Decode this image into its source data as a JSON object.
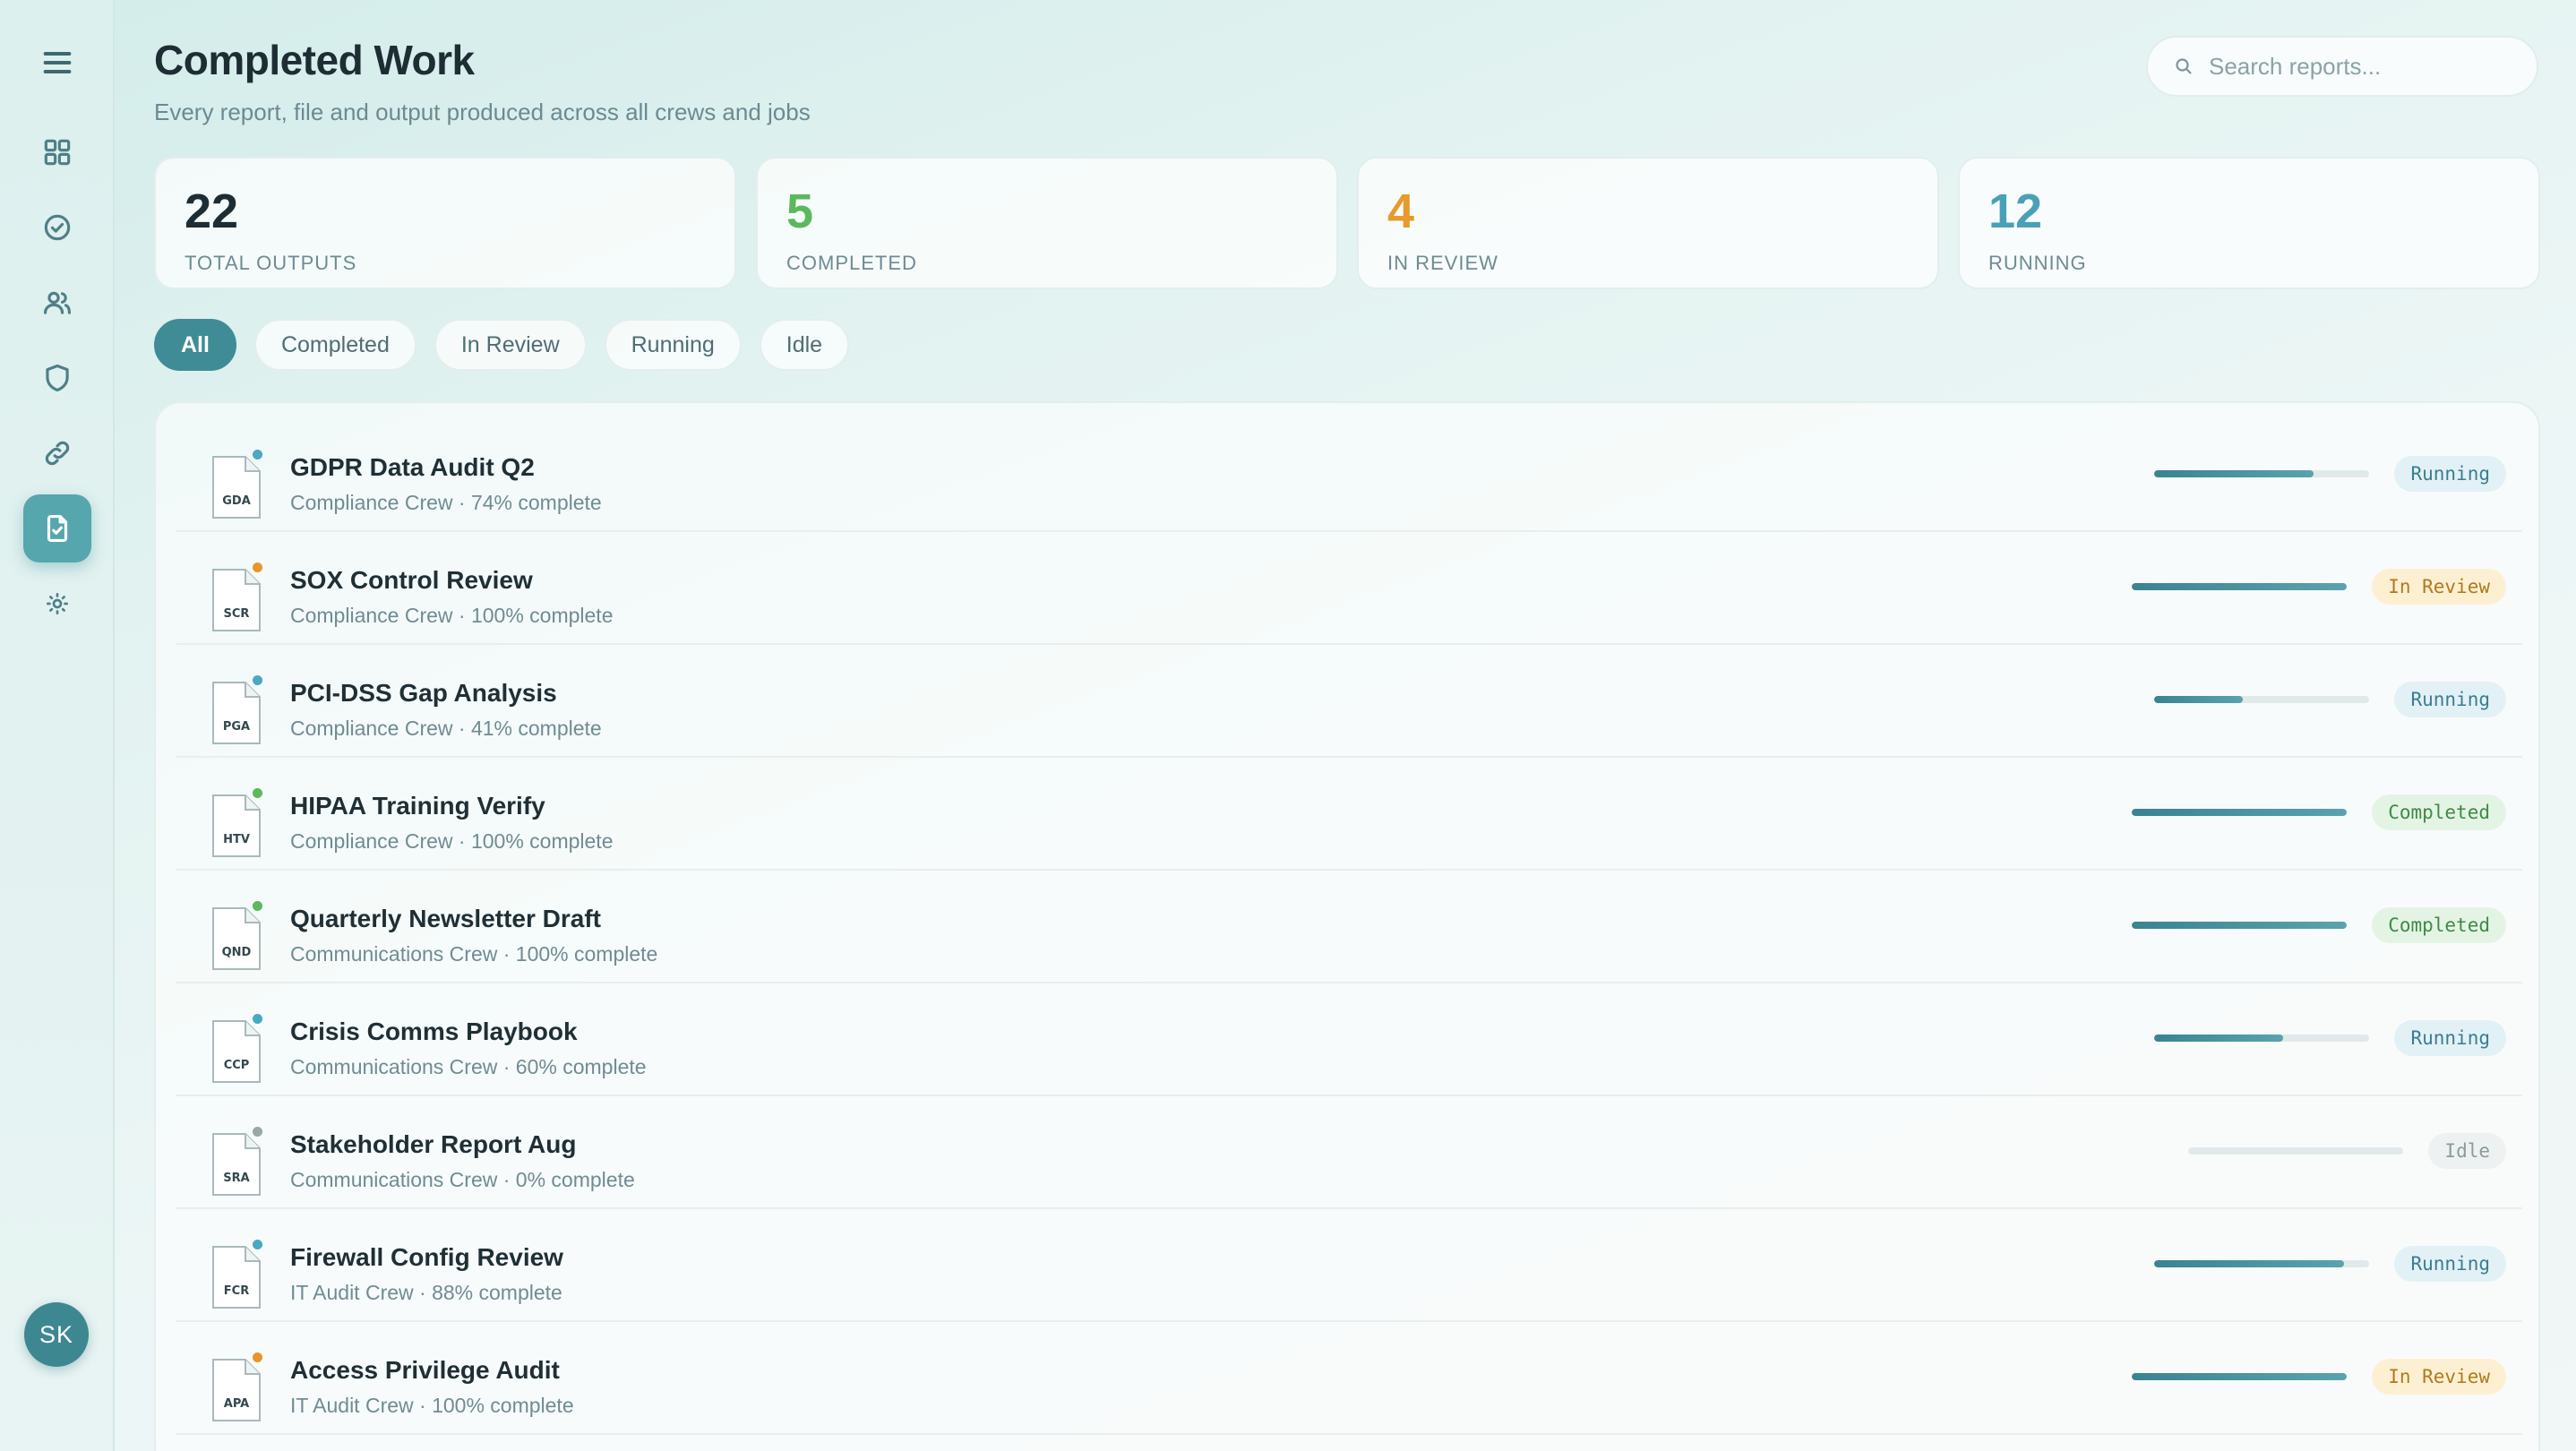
{
  "header": {
    "title": "Completed Work",
    "subtitle": "Every report, file and output produced across all crews and jobs"
  },
  "search": {
    "placeholder": "Search reports..."
  },
  "sidebar": {
    "items": [
      {
        "name": "menu-icon"
      },
      {
        "name": "dashboard-grid-icon"
      },
      {
        "name": "check-circle-icon"
      },
      {
        "name": "users-icon"
      },
      {
        "name": "shield-icon"
      },
      {
        "name": "link-icon"
      },
      {
        "name": "file-check-icon",
        "active": true
      },
      {
        "name": "settings-sun-icon"
      }
    ],
    "avatar_initials": "SK"
  },
  "stats": [
    {
      "value": "22",
      "label": "TOTAL OUTPUTS",
      "color": "#1d2d33"
    },
    {
      "value": "5",
      "label": "COMPLETED",
      "color": "#5cb85c"
    },
    {
      "value": "4",
      "label": "IN REVIEW",
      "color": "#e89a2c"
    },
    {
      "value": "12",
      "label": "RUNNING",
      "color": "#4aa0b6"
    }
  ],
  "filters": [
    {
      "label": "All",
      "active": true
    },
    {
      "label": "Completed",
      "active": false
    },
    {
      "label": "In Review",
      "active": false
    },
    {
      "label": "Running",
      "active": false
    },
    {
      "label": "Idle",
      "active": false
    }
  ],
  "status_colors": {
    "running": "#4aa8c0",
    "review": "#e8962a",
    "completed": "#5cb85c",
    "idle": "#9aa6a8"
  },
  "reports": [
    {
      "abbr": "GDA",
      "title": "GDPR Data Audit Q2",
      "meta": "Compliance Crew · 74% complete",
      "progress": 0.74,
      "status": "running",
      "status_label": "Running"
    },
    {
      "abbr": "SCR",
      "title": "SOX Control Review",
      "meta": "Compliance Crew · 100% complete",
      "progress": 1.0,
      "status": "review",
      "status_label": "In Review"
    },
    {
      "abbr": "PGA",
      "title": "PCI-DSS Gap Analysis",
      "meta": "Compliance Crew · 41% complete",
      "progress": 0.41,
      "status": "running",
      "status_label": "Running"
    },
    {
      "abbr": "HTV",
      "title": "HIPAA Training Verify",
      "meta": "Compliance Crew · 100% complete",
      "progress": 1.0,
      "status": "completed",
      "status_label": "Completed"
    },
    {
      "abbr": "QND",
      "title": "Quarterly Newsletter Draft",
      "meta": "Communications Crew · 100% complete",
      "progress": 1.0,
      "status": "completed",
      "status_label": "Completed"
    },
    {
      "abbr": "CCP",
      "title": "Crisis Comms Playbook",
      "meta": "Communications Crew · 60% complete",
      "progress": 0.6,
      "status": "running",
      "status_label": "Running"
    },
    {
      "abbr": "SRA",
      "title": "Stakeholder Report Aug",
      "meta": "Communications Crew · 0% complete",
      "progress": 0.0,
      "status": "idle",
      "status_label": "Idle"
    },
    {
      "abbr": "FCR",
      "title": "Firewall Config Review",
      "meta": "IT Audit Crew · 88% complete",
      "progress": 0.88,
      "status": "running",
      "status_label": "Running"
    },
    {
      "abbr": "APA",
      "title": "Access Privilege Audit",
      "meta": "IT Audit Crew · 100% complete",
      "progress": 1.0,
      "status": "review",
      "status_label": "In Review"
    }
  ]
}
